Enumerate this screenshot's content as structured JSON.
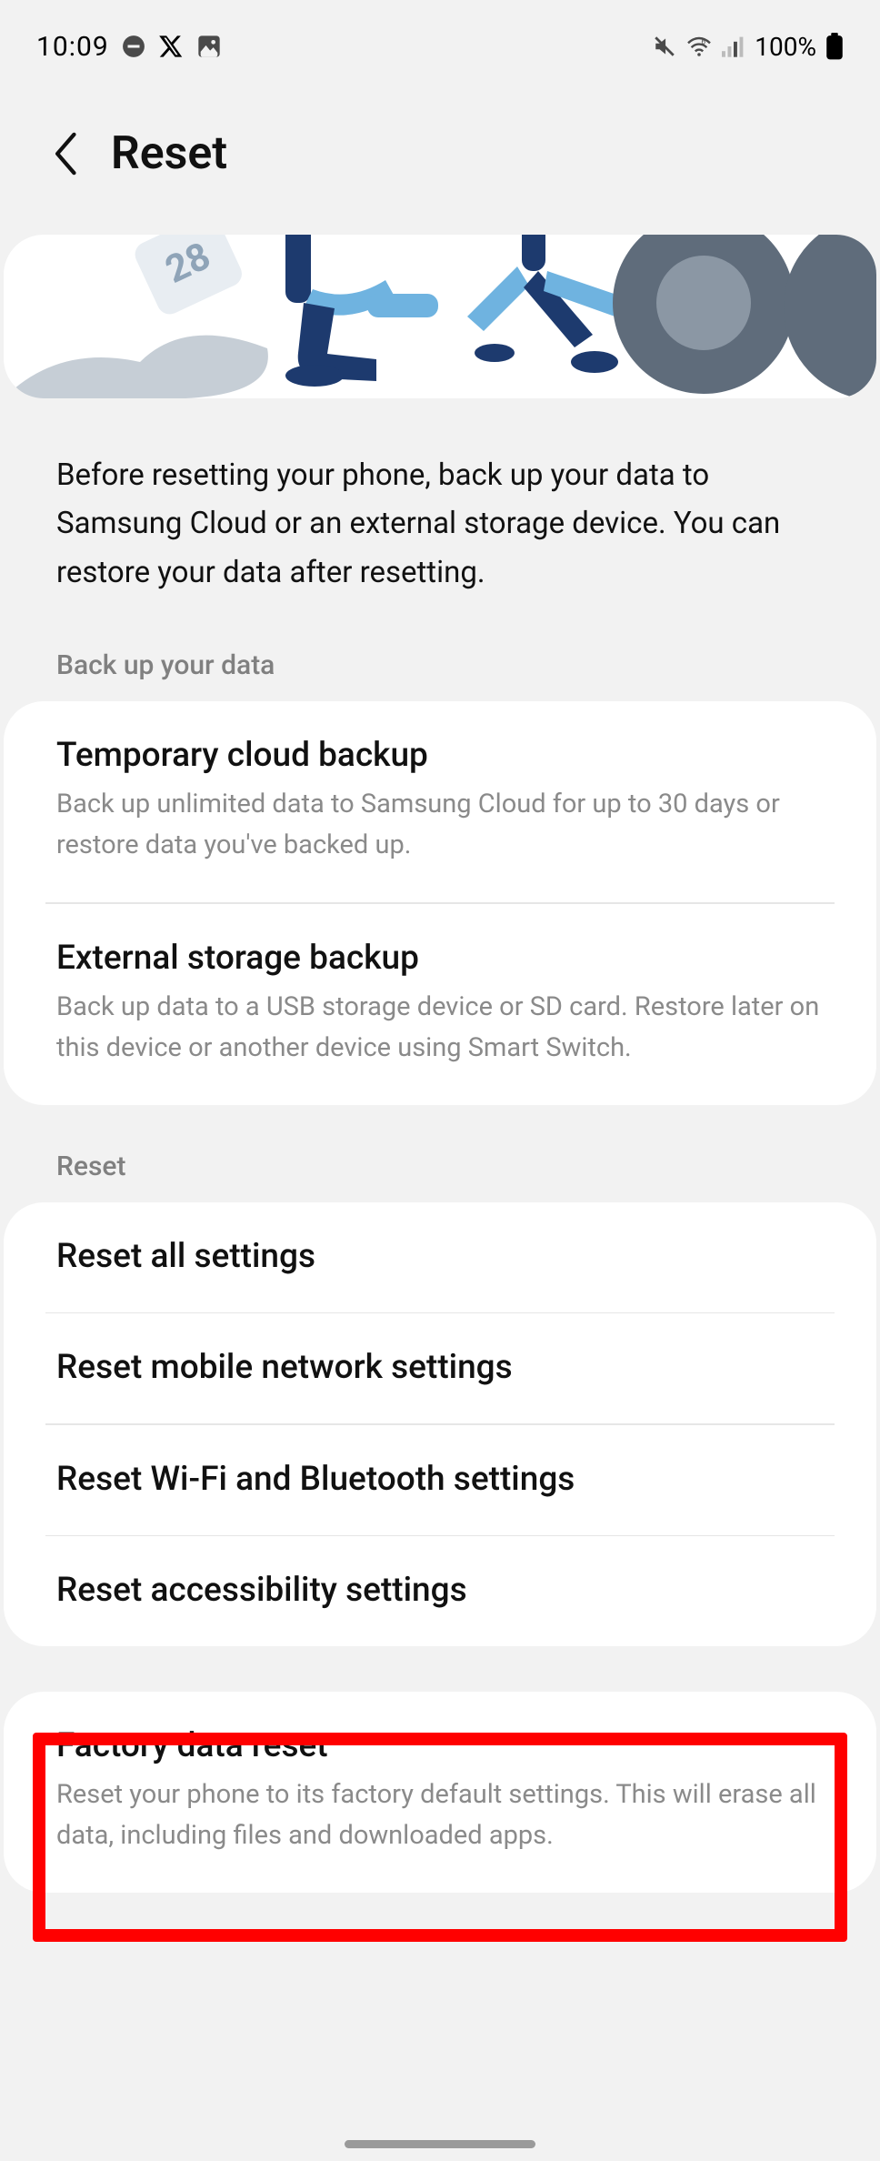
{
  "status": {
    "time": "10:09",
    "battery": "100%"
  },
  "header": {
    "title": "Reset"
  },
  "intro": "Before resetting your phone, back up your data to Samsung Cloud or an external storage device. You can restore your data after resetting.",
  "sections": {
    "backup": {
      "label": "Back up your data",
      "items": [
        {
          "title": "Temporary cloud backup",
          "desc": "Back up unlimited data to Samsung Cloud for up to 30 days or restore data you've backed up."
        },
        {
          "title": "External storage backup",
          "desc": "Back up data to a USB storage device or SD card. Restore later on this device or another device using Smart Switch."
        }
      ]
    },
    "reset": {
      "label": "Reset",
      "items": [
        {
          "title": "Reset all settings"
        },
        {
          "title": "Reset mobile network settings"
        },
        {
          "title": "Reset Wi-Fi and Bluetooth settings"
        },
        {
          "title": "Reset accessibility settings"
        }
      ]
    },
    "factory": {
      "items": [
        {
          "title": "Factory data reset",
          "desc": "Reset your phone to its factory default settings. This will erase all data, including files and downloaded apps."
        }
      ]
    }
  }
}
